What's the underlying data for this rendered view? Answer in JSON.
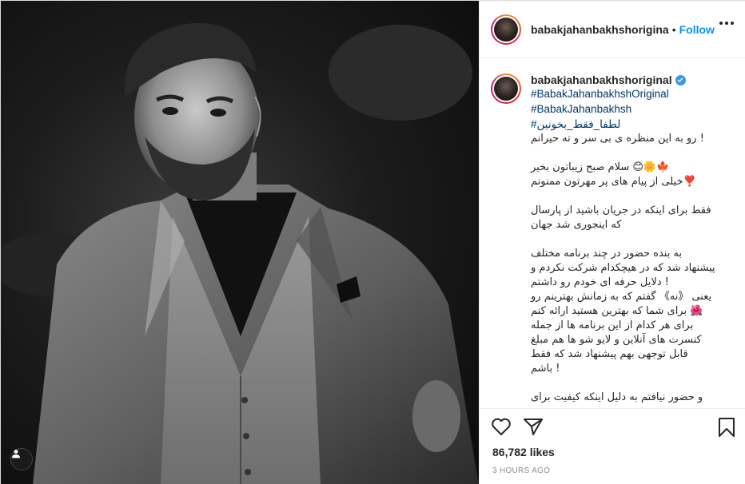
{
  "post": {
    "username": "babakjahanbakhshorigina",
    "follow_label": "Follow",
    "separator": "•"
  },
  "caption": {
    "username": "babakjahanbakhshoriginal",
    "hashtags": [
      "#BabakJahanbakhshOriginal",
      "#BabakJahanbakhsh",
      "#لطفا_فقط_بخونین"
    ],
    "lines": [
      "! رو به این منظره ی بی سر و ته حیرانم",
      "",
      "🍁🌼😊 سلام صبح زیباتون بخیر",
      "❣️خیلی از پیام های پر مهرتون ممنونم",
      "",
      "فقط برای اینکه در جریان باشید از پارسال",
      "که اینجوری شد جهان",
      "",
      "به بنده حضور در چند برنامه مختلف",
      "پیشنهاد شد که در هیچکدام شرکت نکردم و",
      "! دلایل حرفه ای خودم رو داشتم",
      "یعنی 《نه》 گفتم که به زمانش بهترینم رو",
      "🌺 برای شما که بهترین هستید ارائه کنم",
      "برای هر کدام از این برنامه ها از جمله",
      "کنسرت های آنلاین و لایو شو ها هم مبلغ",
      "قابل توجهی بهم پیشنهاد شد که فقط",
      "! باشم",
      "",
      "و حضور نیافتم به دلیل اینکه کیفیت برای"
    ]
  },
  "stats": {
    "likes": "86,782 likes",
    "time": "3 HOURS AGO"
  },
  "icons": {
    "like": "heart-icon",
    "share": "paper-plane-icon",
    "save": "bookmark-icon",
    "more": "more-options-icon",
    "tags": "user-tag-icon",
    "verified": "verified-badge-icon"
  },
  "colors": {
    "accent": "#0095f6",
    "hashtag": "#00376b",
    "meta": "#8e8e8e",
    "verified": "#3897f0"
  }
}
